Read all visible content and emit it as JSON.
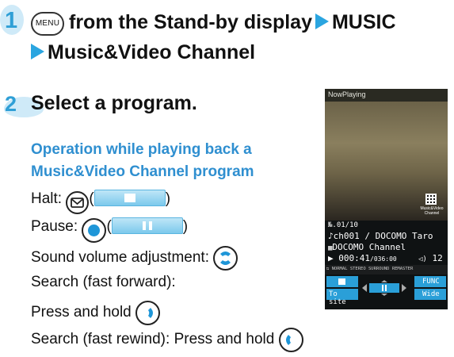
{
  "step1": {
    "number": "1",
    "menu_key": "MENU",
    "text_a": "from the Stand-by display",
    "text_b": "MUSIC",
    "text_c": "Music&Video Channel"
  },
  "step2": {
    "number": "2",
    "title": "Select a program.",
    "heading_line1": "Operation while playing back a",
    "heading_line2": "Music&Video Channel program",
    "halt_label": "Halt:",
    "pause_label": "Pause:",
    "volume_label": "Sound volume adjustment:",
    "ff_label": "Search (fast forward):",
    "ff_hold": "Press and hold",
    "rew_label": "Search (fast rewind): Press and hold"
  },
  "phone": {
    "header": "NowPlaying",
    "logo_line1": "Music&Video",
    "logo_line2": "Channel",
    "track_no": "01/10",
    "channel_line": "ch001 / DOCOMO Taro",
    "program_line": "DOCOMO Channel",
    "time_current": "000:41",
    "time_total": "/036:00",
    "volume": "12",
    "sound_modes": [
      "NORMAL",
      "STEREO",
      "SURROUND",
      "REMASTER"
    ],
    "left_soft": "To site",
    "right_soft_top": "FUNC",
    "right_soft_bottom": "Wide"
  },
  "colors": {
    "accent_blue": "#2f9fd6",
    "arrow_blue": "#2aa5e0",
    "phone_bg": "#0f1213"
  }
}
